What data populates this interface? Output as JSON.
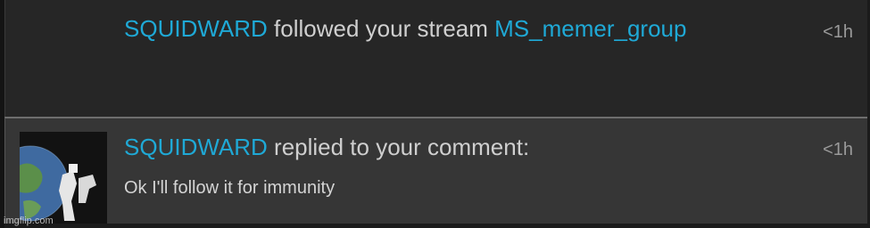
{
  "notifications": [
    {
      "user": "SQUIDWARD",
      "action": " followed your stream ",
      "stream": "MS_memer_group",
      "time": "<1h"
    },
    {
      "user": "SQUIDWARD",
      "action": " replied to your comment:",
      "comment": "Ok I'll follow it for immunity",
      "time": "<1h"
    }
  ],
  "watermark": "imgflip.com",
  "colors": {
    "username": "#1fa9d6",
    "text": "#cfcfcf",
    "timestamp": "#9a9a9a",
    "panel_dark": "#262626",
    "panel_light": "#363636"
  },
  "icons": {
    "avatar": "user-avatar-image"
  }
}
